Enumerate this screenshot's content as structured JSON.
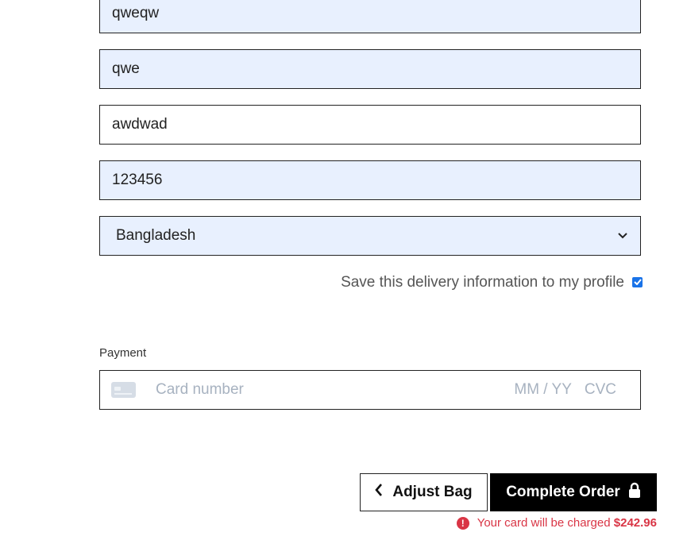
{
  "form": {
    "fields": [
      {
        "value": "qweqw"
      },
      {
        "value": "qwe"
      },
      {
        "value": "awdwad"
      },
      {
        "value": "123456"
      }
    ],
    "country": {
      "selected": "Bangladesh"
    },
    "save_profile": {
      "label": "Save this delivery information to my profile",
      "checked": true
    }
  },
  "payment": {
    "label": "Payment",
    "card_number_placeholder": "Card number",
    "expiry_placeholder": "MM / YY",
    "cvc_placeholder": "CVC"
  },
  "actions": {
    "adjust_label": "Adjust Bag",
    "complete_label": "Complete Order"
  },
  "charge": {
    "text": "Your card will be charged",
    "amount": "$242.96"
  },
  "colors": {
    "autofill_bg": "#e8f0fe",
    "error": "#d93545",
    "checkbox": "#1a73e8"
  }
}
